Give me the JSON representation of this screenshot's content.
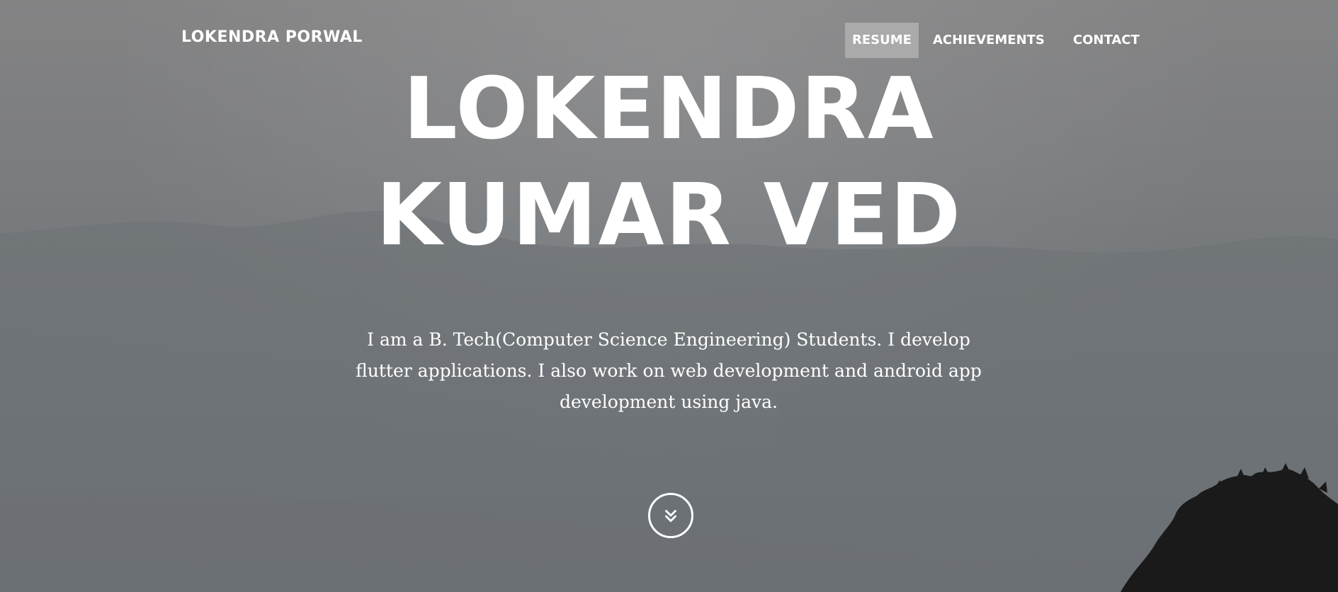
{
  "header": {
    "brand": "LOKENDRA PORWAL",
    "nav": [
      {
        "label": "RESUME",
        "active": true
      },
      {
        "label": "ACHIEVEMENTS",
        "active": false
      },
      {
        "label": "CONTACT",
        "active": false
      }
    ]
  },
  "hero": {
    "title_line1": "LOKENDRA",
    "title_line2": "KUMAR VED",
    "description": "I am a B. Tech(Computer Science Engineering) Students. I develop flutter applications. I also work on web development and android app development using java.",
    "scroll_icon": "double-chevron-down-icon"
  },
  "colors": {
    "text": "#ffffff",
    "nav_active_bg": "#b4b4b4",
    "background_gray": "#777a7d",
    "tree_silhouette": "#1a1a1a"
  }
}
